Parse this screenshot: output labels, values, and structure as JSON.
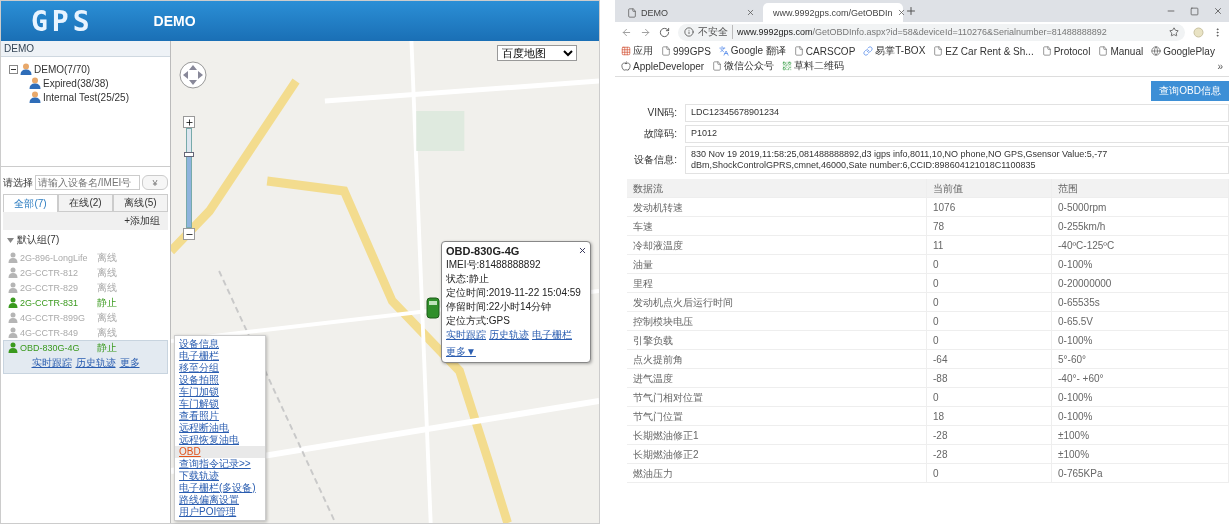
{
  "gps_app": {
    "logo": "GPS",
    "title": "DEMO",
    "sidebar": {
      "header": "DEMO",
      "tree": [
        {
          "label": "DEMO(7/70)",
          "expanded": true,
          "children": [
            {
              "label": "Expired(38/38)"
            },
            {
              "label": "Internal Test(25/25)"
            }
          ]
        }
      ],
      "filter": {
        "label": "请选择",
        "placeholder": "请输入设备名/IMEI号",
        "button": "¥"
      },
      "tabs": [
        {
          "label": "全部(7)",
          "selected": true
        },
        {
          "label": "在线(2)",
          "selected": false
        },
        {
          "label": "离线(5)",
          "selected": false
        }
      ],
      "add_group": "+添加组",
      "group": {
        "label": "默认组(7)",
        "expanded": true
      },
      "devices": [
        {
          "name": "2G-896-LongLife",
          "status": "离线",
          "online": false,
          "selected": false
        },
        {
          "name": "2G-CCTR-812",
          "status": "离线",
          "online": false,
          "selected": false
        },
        {
          "name": "2G-CCTR-829",
          "status": "离线",
          "online": false,
          "selected": false
        },
        {
          "name": "2G-CCTR-831",
          "status": "静止",
          "online": true,
          "selected": false
        },
        {
          "name": "4G-CCTR-899G",
          "status": "离线",
          "online": false,
          "selected": false
        },
        {
          "name": "4G-CCTR-849",
          "status": "离线",
          "online": false,
          "selected": false
        },
        {
          "name": "OBD-830G-4G",
          "status": "静止",
          "online": true,
          "selected": true
        }
      ],
      "device_links": [
        "实时跟踪",
        "历史轨迹",
        "更多"
      ]
    },
    "map": {
      "map_type": "百度地图",
      "zoom": {
        "level": 0.75
      },
      "popup": {
        "title": "OBD-830G-4G",
        "lines": [
          "IMEI号:81488888892",
          "状态:静止",
          "定位时间:2019-11-22 15:04:59",
          "停留时间:22小时14分钟",
          "定位方式:GPS"
        ],
        "links": [
          "实时跟踪",
          "历史轨迹",
          "电子栅栏",
          "更多▼"
        ]
      }
    },
    "context_menu": [
      {
        "label": "设备信息",
        "selected": false
      },
      {
        "label": "电子栅栏",
        "selected": false
      },
      {
        "label": "移至分组",
        "selected": false
      },
      {
        "label": "设备拍照",
        "selected": false
      },
      {
        "label": "车门加锁",
        "selected": false
      },
      {
        "label": "车门解锁",
        "selected": false
      },
      {
        "label": "查看照片",
        "selected": false
      },
      {
        "label": "远程断油电",
        "selected": false
      },
      {
        "label": "远程恢复油电",
        "selected": false
      },
      {
        "label": "OBD",
        "selected": true
      },
      {
        "label": "查询指令记录>>",
        "selected": false
      },
      {
        "label": "下载轨迹",
        "selected": false
      },
      {
        "label": "电子栅栏(多设备)",
        "selected": false
      },
      {
        "label": "路线偏离设置",
        "selected": false
      },
      {
        "label": "用户POI管理",
        "selected": false
      }
    ]
  },
  "browser": {
    "tabs": [
      {
        "title": "DEMO",
        "selected": false
      },
      {
        "title": "www.9992gps.com/GetOBDIn",
        "selected": true
      }
    ],
    "security": "不安全",
    "url": "**www.9992gps.com**/GetOBDInfo.aspx?id=58&deviceId=110276&Serialnumber=81488888892",
    "bookmarks": [
      {
        "label": "应用",
        "kind": "apps"
      },
      {
        "label": "999GPS",
        "kind": "page"
      },
      {
        "label": "Google 翻译",
        "kind": "translate"
      },
      {
        "label": "CARSCOP",
        "kind": "page"
      },
      {
        "label": "易掌T-BOX",
        "kind": "link"
      },
      {
        "label": "EZ Car Rent & Sh...",
        "kind": "page"
      },
      {
        "label": "Protocol",
        "kind": "page"
      },
      {
        "label": "Manual",
        "kind": "page"
      },
      {
        "label": "GooglePlay",
        "kind": "globe"
      },
      {
        "label": "AppleDeveloper",
        "kind": "apple"
      },
      {
        "label": "微信公众号",
        "kind": "page"
      },
      {
        "label": "草料二维码",
        "kind": "qr"
      }
    ],
    "more_bookmarks": "»",
    "query_button": "查询OBD信息",
    "fields": [
      {
        "label": "VIN码:",
        "value": "LDC12345678901234"
      },
      {
        "label": "故障码:",
        "value": "P1012"
      },
      {
        "label": "设备信息:",
        "value": "830 Nov 19 2019,11:58:25,081488888892,d3 igps info,8011,10,NO phone,NO GPS,Gsensor Value:5,-77 dBm,ShockControlGPRS,cmnet,46000,Sate number:6,CCID:898604121018C1100835"
      }
    ],
    "table": {
      "columns": [
        "数据流",
        "当前值",
        "范围"
      ],
      "rows": [
        [
          "发动机转速",
          "1076",
          "0-5000rpm"
        ],
        [
          "车速",
          "78",
          "0-255km/h"
        ],
        [
          "冷却液温度",
          "11",
          "-40ºC-125ºC"
        ],
        [
          "油量",
          "0",
          "0-100%"
        ],
        [
          "里程",
          "0",
          "0-20000000"
        ],
        [
          "发动机点火后运行时间",
          "0",
          "0-65535s"
        ],
        [
          "控制模块电压",
          "0",
          "0-65.5V"
        ],
        [
          "引擎负载",
          "0",
          "0-100%"
        ],
        [
          "点火提前角",
          "-64",
          "5°-60°"
        ],
        [
          "进气温度",
          "-88",
          "-40°- +60°"
        ],
        [
          "节气门相对位置",
          "0",
          "0-100%"
        ],
        [
          "节气门位置",
          "18",
          "0-100%"
        ],
        [
          "长期燃油修正1",
          "-28",
          "±100%"
        ],
        [
          "长期燃油修正2",
          "-28",
          "±100%"
        ],
        [
          "燃油压力",
          "0",
          "0-765KPa"
        ]
      ]
    }
  }
}
